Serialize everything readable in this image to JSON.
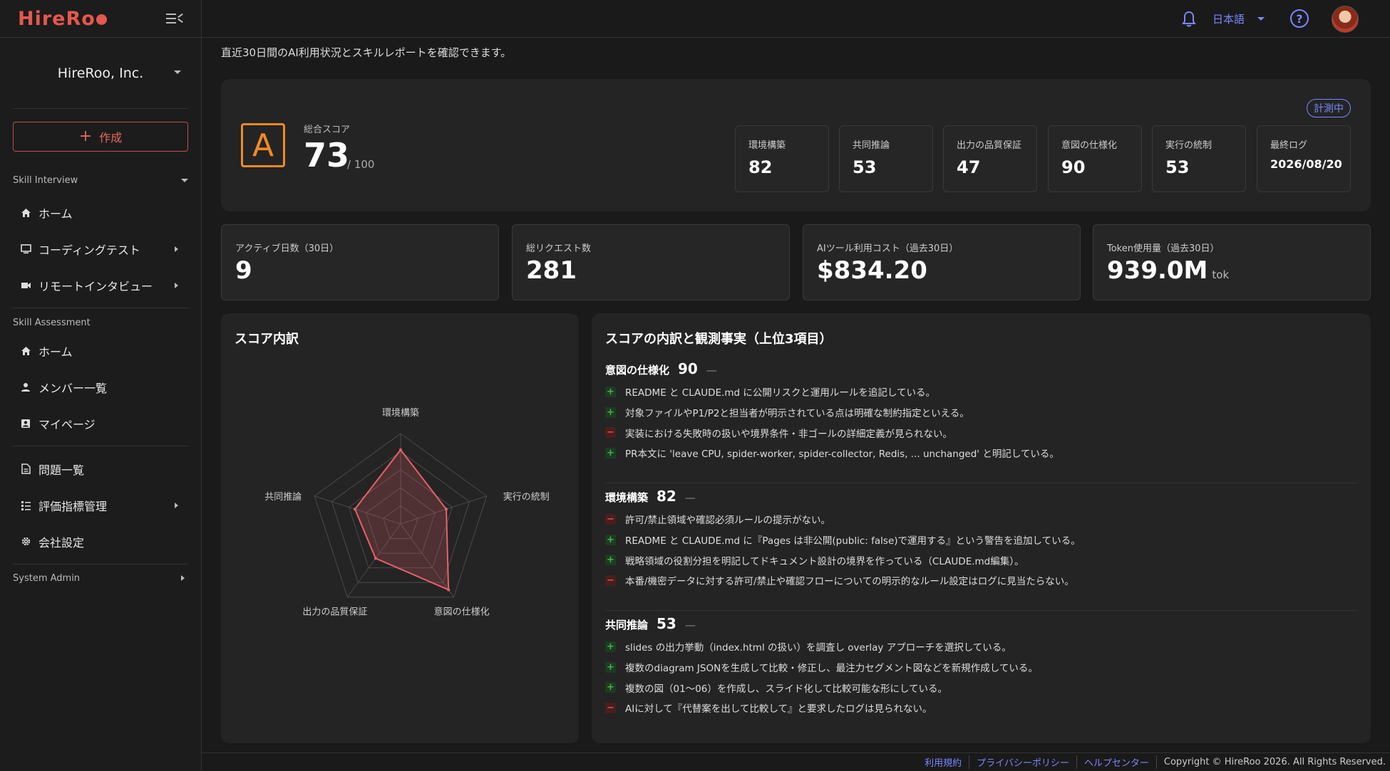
{
  "app": {
    "logo": "HireRoo"
  },
  "sidebar": {
    "org": "HireRoo, Inc.",
    "create_label": "作成",
    "section_interview": "Skill Interview",
    "interview_items": [
      "ホーム",
      "コーディングテスト",
      "リモートインタビュー"
    ],
    "section_assessment": "Skill Assessment",
    "assessment_items": [
      "ホーム",
      "メンバー一覧",
      "マイページ"
    ],
    "other_items": [
      "問題一覧",
      "評価指標管理",
      "会社設定"
    ],
    "section_admin": "System Admin"
  },
  "topbar": {
    "language": "日本語",
    "help_glyph": "?"
  },
  "page": {
    "subtitle": "直近30日間のAI利用状況とスキルレポートを確認できます。"
  },
  "score": {
    "grade": "A",
    "label": "総合スコア",
    "value": "73",
    "max": "/ 100",
    "badge": "計測中",
    "metrics": [
      {
        "label": "環境構築",
        "value": "82"
      },
      {
        "label": "共同推論",
        "value": "53"
      },
      {
        "label": "出力の品質保証",
        "value": "47"
      },
      {
        "label": "意図の仕様化",
        "value": "90"
      },
      {
        "label": "実行の統制",
        "value": "53"
      },
      {
        "label": "最終ログ",
        "value": "2026/08/20"
      }
    ]
  },
  "stats": [
    {
      "label": "アクティブ日数（30日）",
      "value": "9",
      "unit": ""
    },
    {
      "label": "総リクエスト数",
      "value": "281",
      "unit": ""
    },
    {
      "label": "AIツール利用コスト（過去30日）",
      "value": "$834.20",
      "unit": ""
    },
    {
      "label": "Token使用量（過去30日）",
      "value": "939.0M",
      "unit": "tok"
    }
  ],
  "radar": {
    "title": "スコア内訳",
    "axes": [
      "環境構築",
      "実行の統制",
      "意図の仕様化",
      "出力の品質保証",
      "共同推論"
    ],
    "values": [
      82,
      53,
      90,
      47,
      53
    ],
    "max": 100,
    "color": "#e8606a"
  },
  "observations": {
    "title": "スコアの内訳と観測事実（上位3項目）",
    "sections": [
      {
        "name": "意図の仕様化",
        "score": "90",
        "dash": "—",
        "items": [
          {
            "type": "+",
            "text": "README と CLAUDE.md に公開リスクと運用ルールを追記している。"
          },
          {
            "type": "+",
            "text": "対象ファイルやP1/P2と担当者が明示されている点は明確な制約指定といえる。"
          },
          {
            "type": "−",
            "text": "実装における失敗時の扱いや境界条件・非ゴールの詳細定義が見られない。"
          },
          {
            "type": "+",
            "text": "PR本文に 'leave CPU, spider-worker, spider-collector, Redis, ... unchanged' と明記している。"
          }
        ]
      },
      {
        "name": "環境構築",
        "score": "82",
        "dash": "—",
        "items": [
          {
            "type": "−",
            "text": "許可/禁止領域や確認必須ルールの提示がない。"
          },
          {
            "type": "+",
            "text": "README と CLAUDE.md に『Pages は非公開(public: false)で運用する』という警告を追加している。"
          },
          {
            "type": "+",
            "text": "戦略領域の役割分担を明記してドキュメント設計の境界を作っている（CLAUDE.md編集）。"
          },
          {
            "type": "−",
            "text": "本番/機密データに対する許可/禁止や確認フローについての明示的なルール設定はログに見当たらない。"
          }
        ]
      },
      {
        "name": "共同推論",
        "score": "53",
        "dash": "—",
        "items": [
          {
            "type": "+",
            "text": "slides の出力挙動（index.html の扱い）を調査し overlay アプローチを選択している。"
          },
          {
            "type": "+",
            "text": "複数のdiagram JSONを生成して比較・修正し、最注力セグメント図などを新規作成している。"
          },
          {
            "type": "+",
            "text": "複数の図（01〜06）を作成し、スライド化して比較可能な形にしている。"
          },
          {
            "type": "−",
            "text": "AIに対して『代替案を出して比較して』と要求したログは見られない。"
          }
        ]
      }
    ]
  },
  "footer": {
    "links": [
      "利用規約",
      "プライバシーポリシー",
      "ヘルプセンター"
    ],
    "copyright": "Copyright © HireRoo 2026. All Rights Reserved."
  },
  "colors": {
    "accent": "#7a88ff",
    "brand": "#e4584e",
    "grade": "#f08a24"
  }
}
